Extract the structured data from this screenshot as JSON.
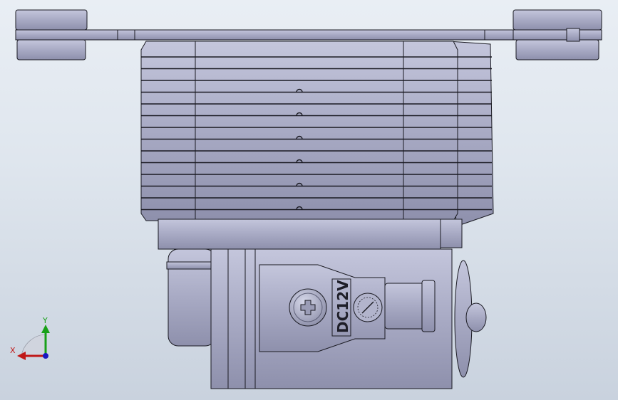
{
  "viewport": {
    "background_top": "#e9eef4",
    "background_bottom": "#c9d2de"
  },
  "part": {
    "body_color": "#a6a8c2",
    "edge_color": "#1a1a22",
    "connector_label": "DC12V",
    "connector_rotation_indicator": "dial-icon",
    "screw_icon": "phillips-screw-icon"
  },
  "triad": {
    "x_label": "X",
    "y_label": "Y",
    "x_color": "#c01818",
    "y_color": "#18a018",
    "z_color": "#1818c0"
  }
}
